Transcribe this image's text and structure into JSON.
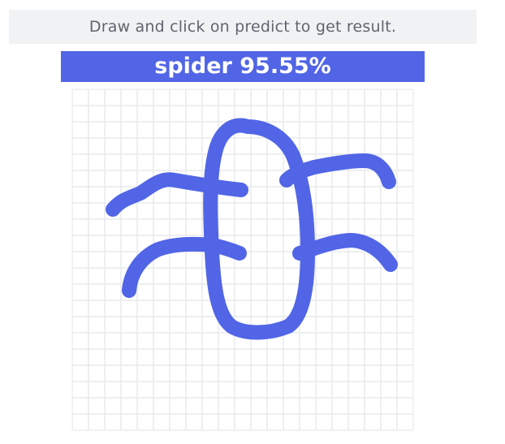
{
  "instruction": {
    "text": "Draw and click on predict to get result."
  },
  "result": {
    "label": "spider 95.55%"
  },
  "canvas": {
    "grid_color": "#e9eaec",
    "stroke_color": "#5165e6"
  },
  "colors": {
    "accent": "#5165e6",
    "instruction_bg": "#f1f2f3",
    "instruction_text": "#5f6570"
  }
}
